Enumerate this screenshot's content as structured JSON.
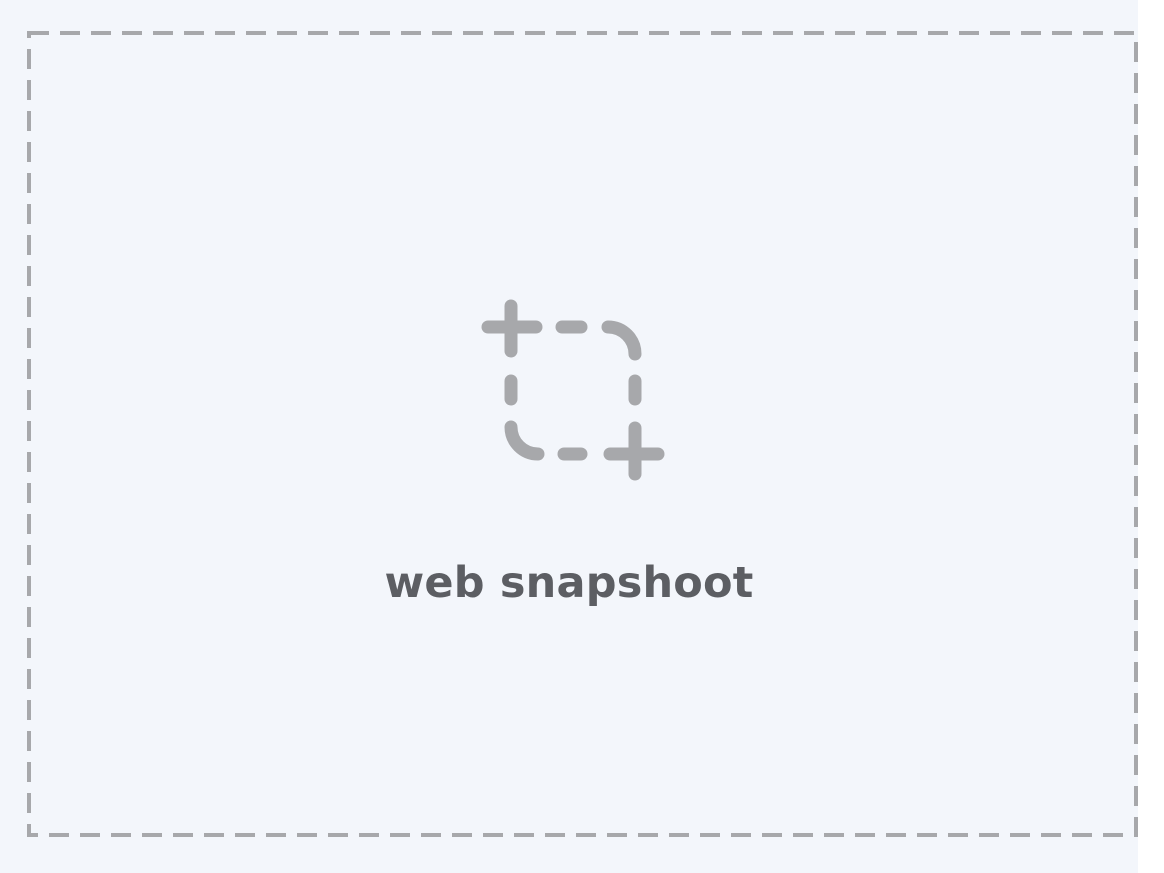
{
  "dropzone": {
    "label": "web snapshoot",
    "icon": "screenshot-capture-icon"
  },
  "colors": {
    "background": "#f3f6fb",
    "dashed_border": "#a7a8ab",
    "icon": "#a7a8ab",
    "label_text": "#5c5e63"
  }
}
